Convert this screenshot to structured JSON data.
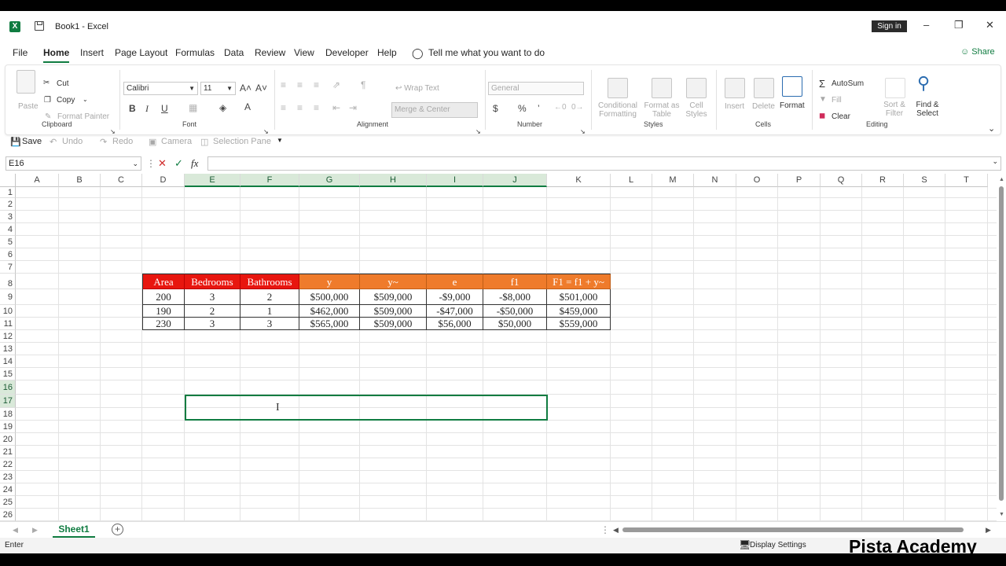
{
  "titlebar": {
    "doc": "Book1",
    "sep": " - ",
    "app": "Excel",
    "signin": "Sign in",
    "minimize": "–",
    "restore": "❐",
    "close": "✕"
  },
  "menu": {
    "tabs": [
      "File",
      "Home",
      "Insert",
      "Page Layout",
      "Formulas",
      "Data",
      "Review",
      "View",
      "Developer",
      "Help"
    ],
    "tell_me": "Tell me what you want to do",
    "share": "Share"
  },
  "ribbon": {
    "clipboard": {
      "paste": "Paste",
      "cut": "Cut",
      "copy": "Copy",
      "format_painter": "Format Painter",
      "label": "Clipboard"
    },
    "font": {
      "name": "Calibri",
      "size": "11",
      "label": "Font",
      "bold": "B",
      "italic": "I",
      "underline": "U",
      "grow": "A˄",
      "shrink": "A˅",
      "fontcolor": "A"
    },
    "alignment": {
      "wrap_text": "Wrap Text",
      "merge_center": "Merge & Center",
      "label": "Alignment"
    },
    "number": {
      "format": "General",
      "label": "Number",
      "currency": "$",
      "percent": "%",
      "comma": "’"
    },
    "styles": {
      "conditional_1": "Conditional",
      "conditional_2": "Formatting",
      "format_table_1": "Format as",
      "format_table_2": "Table",
      "cell_styles_1": "Cell",
      "cell_styles_2": "Styles",
      "label": "Styles"
    },
    "cells": {
      "insert": "Insert",
      "delete": "Delete",
      "format": "Format",
      "label": "Cells"
    },
    "editing": {
      "autosum": "AutoSum",
      "fill": "Fill",
      "clear": "Clear",
      "sort_1": "Sort &",
      "sort_2": "Filter",
      "find_1": "Find &",
      "find_2": "Select",
      "label": "Editing"
    }
  },
  "qat": {
    "save": "Save",
    "undo": "Undo",
    "redo": "Redo",
    "camera": "Camera",
    "selection_pane": "Selection Pane"
  },
  "formula_bar": {
    "name_box": "E16",
    "fx": "fx",
    "value": ""
  },
  "sheet": {
    "columns": [
      "A",
      "B",
      "C",
      "D",
      "E",
      "F",
      "G",
      "H",
      "I",
      "J",
      "K",
      "L",
      "M",
      "N",
      "O",
      "P",
      "Q",
      "R",
      "S",
      "T"
    ],
    "rows": [
      "1",
      "2",
      "3",
      "4",
      "5",
      "6",
      "7",
      "8",
      "9",
      "10",
      "11",
      "12",
      "13",
      "14",
      "15",
      "16",
      "17",
      "18",
      "19",
      "20",
      "21",
      "22",
      "23",
      "24",
      "25",
      "26"
    ],
    "table": {
      "headers": [
        "Area",
        "Bedrooms",
        "Bathrooms",
        "y",
        "y~",
        "e",
        "f1",
        "F1 = f1 + y~"
      ],
      "rows": [
        [
          "200",
          "3",
          "2",
          "$500,000",
          "$509,000",
          "-$9,000",
          "-$8,000",
          "$501,000"
        ],
        [
          "190",
          "2",
          "1",
          "$462,000",
          "$509,000",
          "-$47,000",
          "-$50,000",
          "$459,000"
        ],
        [
          "230",
          "3",
          "3",
          "$565,000",
          "$509,000",
          "$56,000",
          "$50,000",
          "$559,000"
        ]
      ]
    },
    "tabs": [
      "Sheet1"
    ],
    "add_sheet": "+"
  },
  "status": {
    "mode": "Enter",
    "display_settings": "Display Settings"
  },
  "watermark": "Pista Academy",
  "colors": {
    "accent": "#107c41",
    "header_red": "#e8160f",
    "header_orange": "#ef7b2b"
  }
}
